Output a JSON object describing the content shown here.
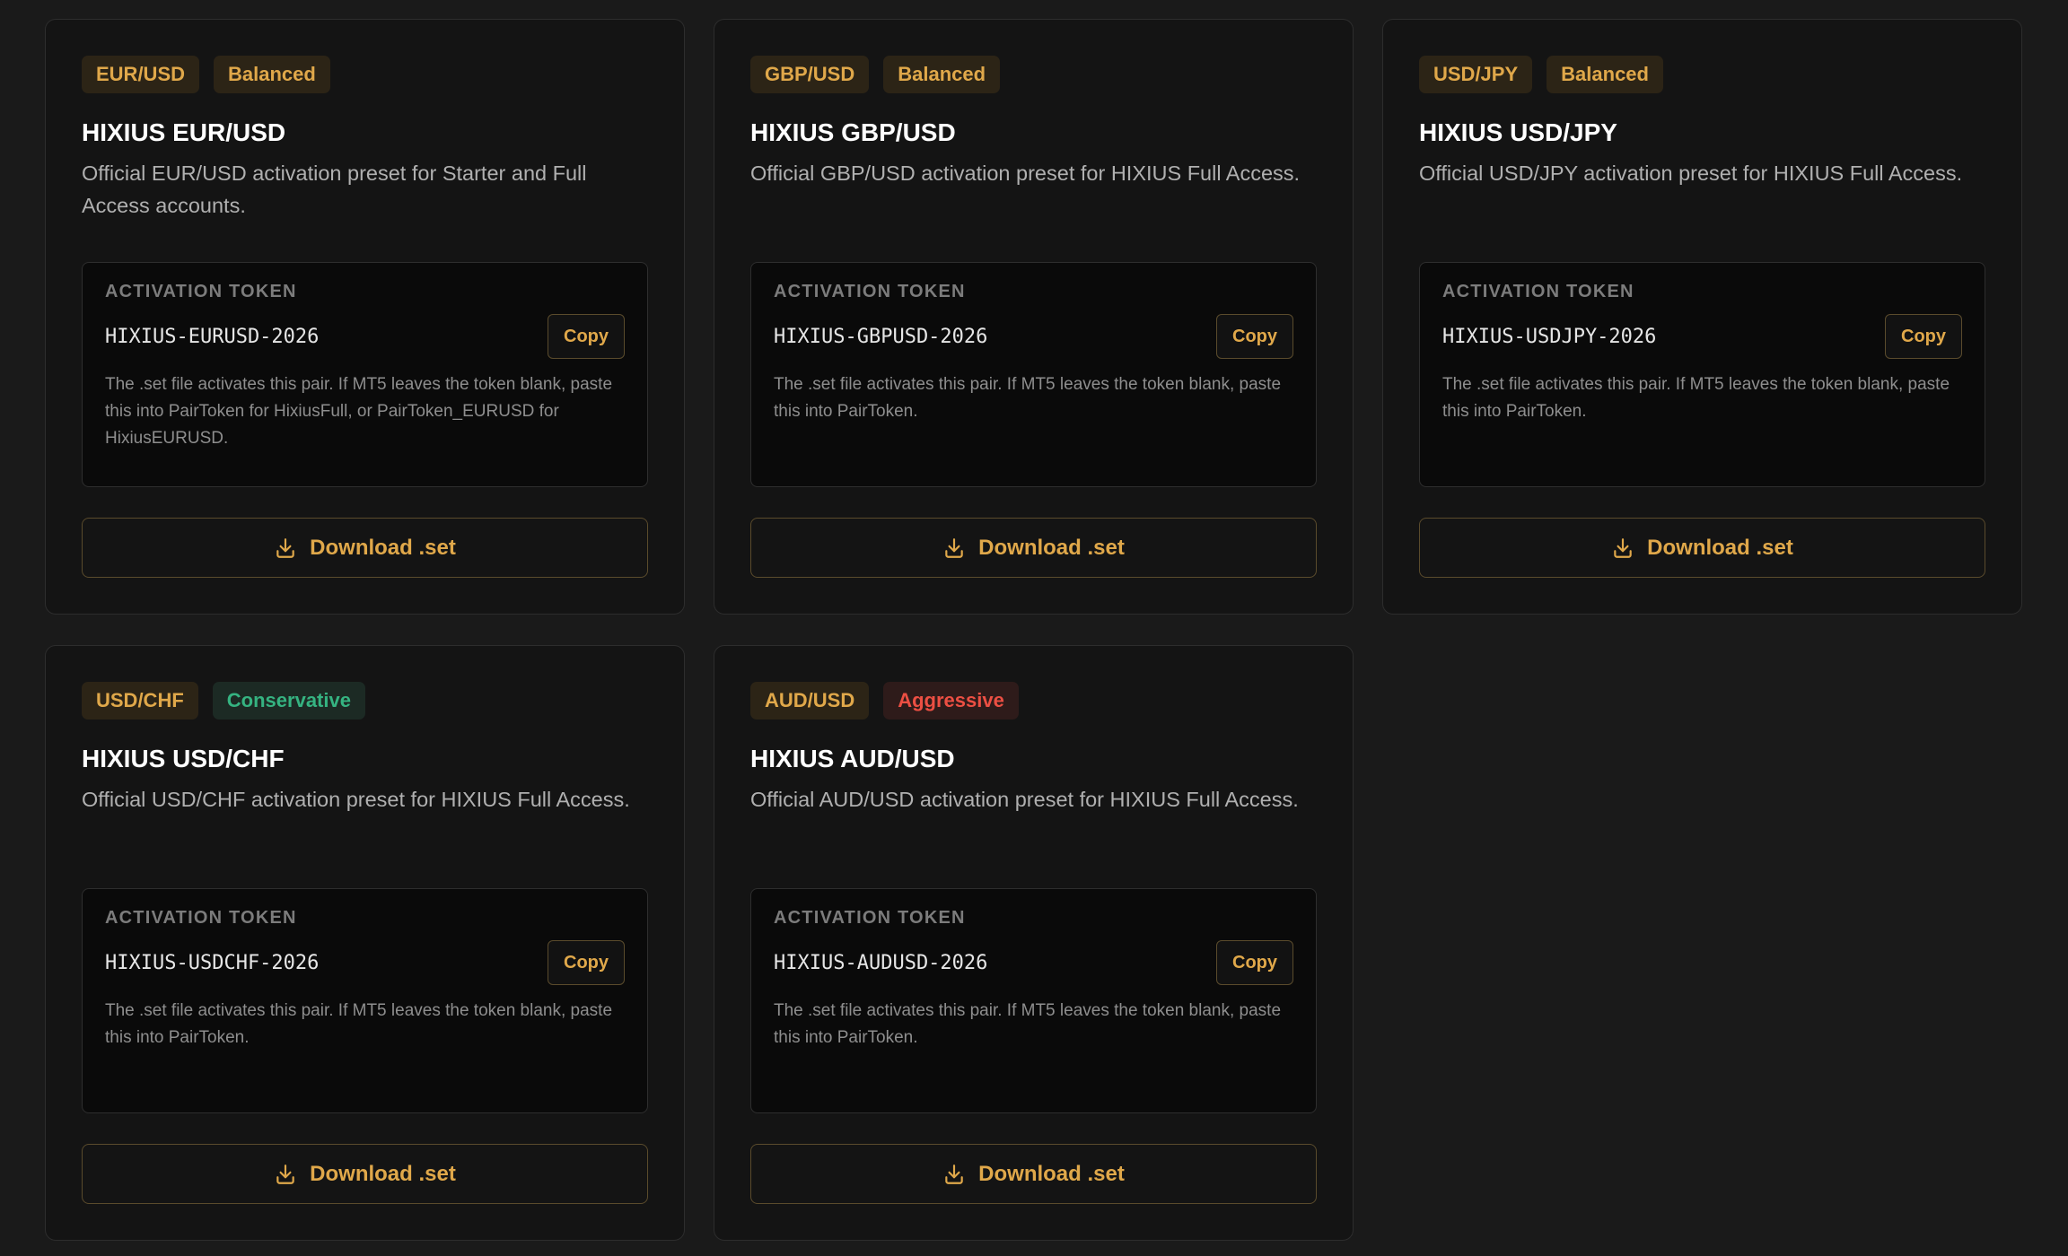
{
  "colors": {
    "accent": "#e0a84a",
    "conservative": "#35b381",
    "aggressive": "#ec4f43",
    "background": "#1a1a1a",
    "card": "#141414"
  },
  "cards": [
    {
      "pair": "EUR/USD",
      "risk": "Balanced",
      "risk_class": "balanced",
      "title": "HIXIUS EUR/USD",
      "description": "Official EUR/USD activation preset for Starter and Full Access accounts.",
      "token_label": "ACTIVATION TOKEN",
      "token": "HIXIUS-EURUSD-2026",
      "copy_label": "Copy",
      "note": "The .set file activates this pair. If MT5 leaves the token blank, paste this into PairToken for HixiusFull, or PairToken_EURUSD for HixiusEURUSD.",
      "download_label": "Download .set",
      "download_icon": "download-icon"
    },
    {
      "pair": "GBP/USD",
      "risk": "Balanced",
      "risk_class": "balanced",
      "title": "HIXIUS GBP/USD",
      "description": "Official GBP/USD activation preset for HIXIUS Full Access.",
      "token_label": "ACTIVATION TOKEN",
      "token": "HIXIUS-GBPUSD-2026",
      "copy_label": "Copy",
      "note": "The .set file activates this pair. If MT5 leaves the token blank, paste this into PairToken.",
      "download_label": "Download .set",
      "download_icon": "download-icon"
    },
    {
      "pair": "USD/JPY",
      "risk": "Balanced",
      "risk_class": "balanced",
      "title": "HIXIUS USD/JPY",
      "description": "Official USD/JPY activation preset for HIXIUS Full Access.",
      "token_label": "ACTIVATION TOKEN",
      "token": "HIXIUS-USDJPY-2026",
      "copy_label": "Copy",
      "note": "The .set file activates this pair. If MT5 leaves the token blank, paste this into PairToken.",
      "download_label": "Download .set",
      "download_icon": "download-icon"
    },
    {
      "pair": "USD/CHF",
      "risk": "Conservative",
      "risk_class": "conservative",
      "title": "HIXIUS USD/CHF",
      "description": "Official USD/CHF activation preset for HIXIUS Full Access.",
      "token_label": "ACTIVATION TOKEN",
      "token": "HIXIUS-USDCHF-2026",
      "copy_label": "Copy",
      "note": "The .set file activates this pair. If MT5 leaves the token blank, paste this into PairToken.",
      "download_label": "Download .set",
      "download_icon": "download-icon"
    },
    {
      "pair": "AUD/USD",
      "risk": "Aggressive",
      "risk_class": "aggressive",
      "title": "HIXIUS AUD/USD",
      "description": "Official AUD/USD activation preset for HIXIUS Full Access.",
      "token_label": "ACTIVATION TOKEN",
      "token": "HIXIUS-AUDUSD-2026",
      "copy_label": "Copy",
      "note": "The .set file activates this pair. If MT5 leaves the token blank, paste this into PairToken.",
      "download_label": "Download .set",
      "download_icon": "download-icon"
    }
  ]
}
